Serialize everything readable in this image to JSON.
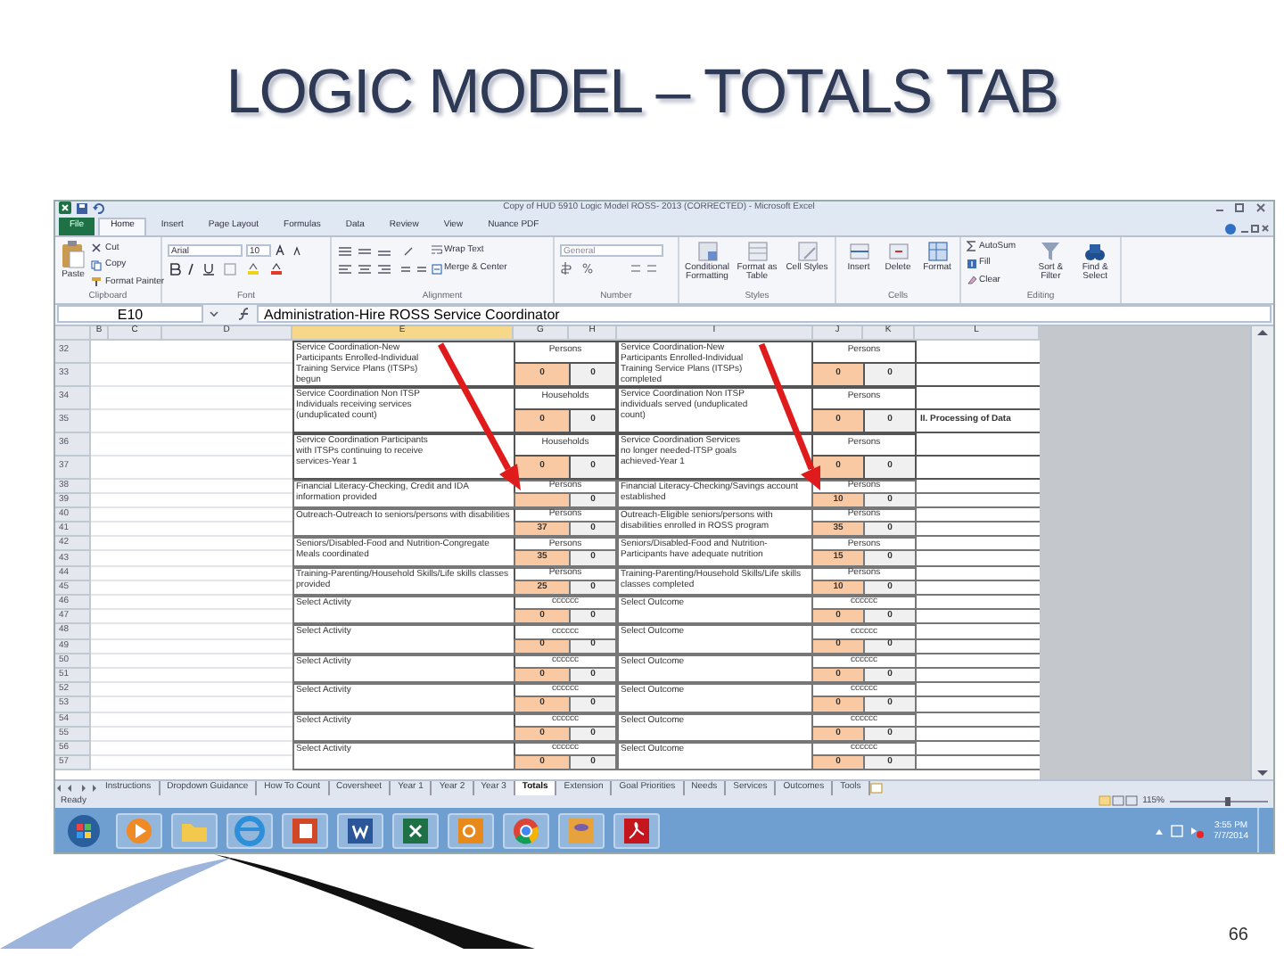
{
  "slide": {
    "title": "LOGIC MODEL – TOTALS TAB",
    "page_number": "66"
  },
  "excel": {
    "window_title": "Copy of HUD 5910 Logic Model ROSS- 2013 (CORRECTED) - Microsoft Excel",
    "ribbon_tabs": [
      {
        "label": "File",
        "kind": "file",
        "selected": false
      },
      {
        "label": "Home",
        "kind": "tab",
        "selected": true
      },
      {
        "label": "Insert",
        "kind": "tab",
        "selected": false
      },
      {
        "label": "Page Layout",
        "kind": "tab",
        "selected": false
      },
      {
        "label": "Formulas",
        "kind": "tab",
        "selected": false
      },
      {
        "label": "Data",
        "kind": "tab",
        "selected": false
      },
      {
        "label": "Review",
        "kind": "tab",
        "selected": false
      },
      {
        "label": "View",
        "kind": "tab",
        "selected": false
      },
      {
        "label": "Nuance PDF",
        "kind": "tab",
        "selected": false
      }
    ],
    "clipboard": {
      "paste": "Paste",
      "cut": "Cut",
      "copy": "Copy",
      "format_painter": "Format Painter",
      "label": "Clipboard"
    },
    "font": {
      "name": "Arial",
      "size": "10",
      "label": "Font"
    },
    "alignment": {
      "wrap": "Wrap Text",
      "merge": "Merge & Center",
      "label": "Alignment"
    },
    "number": {
      "format": "General",
      "label": "Number"
    },
    "styles": {
      "buttons": [
        "Conditional Formatting",
        "Format as Table",
        "Cell Styles"
      ],
      "label": "Styles"
    },
    "cells": {
      "buttons": [
        "Insert",
        "Delete",
        "Format"
      ],
      "label": "Cells"
    },
    "editing": {
      "autosum": "AutoSum",
      "fill": "Fill",
      "clear": "Clear",
      "sort": "Sort & Filter",
      "find": "Find & Select",
      "label": "Editing"
    },
    "name_box": "E10",
    "formula": "Administration-Hire ROSS Service Coordinator",
    "columns": [
      {
        "label": "B",
        "selected": false
      },
      {
        "label": "C",
        "selected": false
      },
      {
        "label": "D",
        "selected": false
      },
      {
        "label": "E",
        "selected": true
      },
      {
        "label": "G",
        "selected": false
      },
      {
        "label": "H",
        "selected": false
      },
      {
        "label": "I",
        "selected": false
      },
      {
        "label": "J",
        "selected": false
      },
      {
        "label": "K",
        "selected": false
      },
      {
        "label": "L",
        "selected": false
      }
    ],
    "row_numbers": [
      "32",
      "33",
      "34",
      "35",
      "36",
      "37",
      "38",
      "39",
      "40",
      "41",
      "42",
      "43",
      "44",
      "45",
      "46",
      "47",
      "48",
      "49",
      "50",
      "51",
      "52",
      "53",
      "54",
      "55",
      "56",
      "57"
    ],
    "blocks": [
      {
        "activity": "Service Coordination-New Participants Enrolled-Individual Training Service Plans (ITSPs) begun",
        "activity_unit": "Persons",
        "activity_value": "0",
        "activity_value_2": "0",
        "outcome": "Service Coordination-New Participants Enrolled-Individual Training Service Plans (ITSPs) completed",
        "outcome_unit": "Persons",
        "outcome_value": "0",
        "outcome_value_2": "0"
      },
      {
        "activity": "Service Coordination Non ITSP Individuals receiving services (unduplicated count)",
        "activity_unit": "Households",
        "activity_value": "0",
        "activity_value_2": "0",
        "outcome": "Service Coordination Non ITSP individuals served (unduplicated count)",
        "outcome_unit": "Persons",
        "outcome_value": "0",
        "outcome_value_2": "0",
        "note": "II.  Processing of Data"
      },
      {
        "activity": "Service Coordination Participants with ITSPs continuing to receive services-Year 1",
        "activity_unit": "Households",
        "activity_value": "0",
        "activity_value_2": "0",
        "outcome": "Service Coordination Services no longer needed-ITSP goals achieved-Year 1",
        "outcome_unit": "Persons",
        "outcome_value": "0",
        "outcome_value_2": "0"
      },
      {
        "activity": "Financial Literacy-Checking, Credit and IDA information provided",
        "activity_unit": "Persons",
        "activity_value_2": "0",
        "outcome": "Financial Literacy-Checking/Savings account established",
        "outcome_unit": "Persons",
        "outcome_value": "10",
        "outcome_value_2": "0"
      },
      {
        "activity": "Outreach-Outreach to seniors/persons with disabilities",
        "activity_unit": "Persons",
        "activity_value": "37",
        "activity_value_2": "0",
        "outcome": "Outreach-Eligible seniors/persons with disabilities enrolled in ROSS program",
        "outcome_unit": "Persons",
        "outcome_value": "35",
        "outcome_value_2": "0"
      },
      {
        "activity": "Seniors/Disabled-Food and Nutrition-Congregate Meals coordinated",
        "activity_unit": "Persons",
        "activity_value": "35",
        "activity_value_2": "0",
        "outcome": "Seniors/Disabled-Food and Nutrition-Participants have adequate nutrition",
        "outcome_unit": "Persons",
        "outcome_value": "15",
        "outcome_value_2": "0"
      },
      {
        "activity": "Training-Parenting/Household Skills/Life skills classes provided",
        "activity_unit": "Persons",
        "activity_value": "25",
        "activity_value_2": "0",
        "outcome": "Training-Parenting/Household Skills/Life skills classes completed",
        "outcome_unit": "Persons",
        "outcome_value": "10",
        "outcome_value_2": "0"
      },
      {
        "activity": "Select Activity",
        "activity_unit": "cccccc",
        "activity_value": "0",
        "activity_value_2": "0",
        "outcome": "Select Outcome",
        "outcome_unit": "cccccc",
        "outcome_value": "0",
        "outcome_value_2": "0"
      },
      {
        "activity": "Select Activity",
        "activity_unit": "cccccc",
        "activity_value": "0",
        "activity_value_2": "0",
        "outcome": "Select Outcome",
        "outcome_unit": "cccccc",
        "outcome_value": "0",
        "outcome_value_2": "0"
      },
      {
        "activity": "Select Activity",
        "activity_unit": "cccccc",
        "activity_value": "0",
        "activity_value_2": "0",
        "outcome": "Select Outcome",
        "outcome_unit": "cccccc",
        "outcome_value": "0",
        "outcome_value_2": "0"
      },
      {
        "activity": "Select Activity",
        "activity_unit": "cccccc",
        "activity_value": "0",
        "activity_value_2": "0",
        "outcome": "Select Outcome",
        "outcome_unit": "cccccc",
        "outcome_value": "0",
        "outcome_value_2": "0"
      },
      {
        "activity": "Select Activity",
        "activity_unit": "cccccc",
        "activity_value": "0",
        "activity_value_2": "0",
        "outcome": "Select Outcome",
        "outcome_unit": "cccccc",
        "outcome_value": "0",
        "outcome_value_2": "0"
      },
      {
        "activity": "Select Activity",
        "activity_unit": "cccccc",
        "activity_value": "0",
        "activity_value_2": "0",
        "outcome": "Select Outcome",
        "outcome_unit": "cccccc",
        "outcome_value": "0",
        "outcome_value_2": "0"
      }
    ],
    "sheet_tabs": [
      {
        "label": "Instructions",
        "selected": false
      },
      {
        "label": "Dropdown Guidance",
        "selected": false
      },
      {
        "label": "How To Count",
        "selected": false
      },
      {
        "label": "Coversheet",
        "selected": false
      },
      {
        "label": "Year 1",
        "selected": false
      },
      {
        "label": "Year 2",
        "selected": false
      },
      {
        "label": "Year 3",
        "selected": false
      },
      {
        "label": "Totals",
        "selected": true
      },
      {
        "label": "Extension",
        "selected": false
      },
      {
        "label": "Goal Priorities",
        "selected": false
      },
      {
        "label": "Needs",
        "selected": false
      },
      {
        "label": "Services",
        "selected": false
      },
      {
        "label": "Outcomes",
        "selected": false
      },
      {
        "label": "Tools",
        "selected": false
      }
    ],
    "status": "Ready",
    "zoom": "115%",
    "zoom_slider": {
      "level": 0.6
    },
    "clock": {
      "time": "3:55 PM",
      "date": "7/7/2014"
    }
  }
}
